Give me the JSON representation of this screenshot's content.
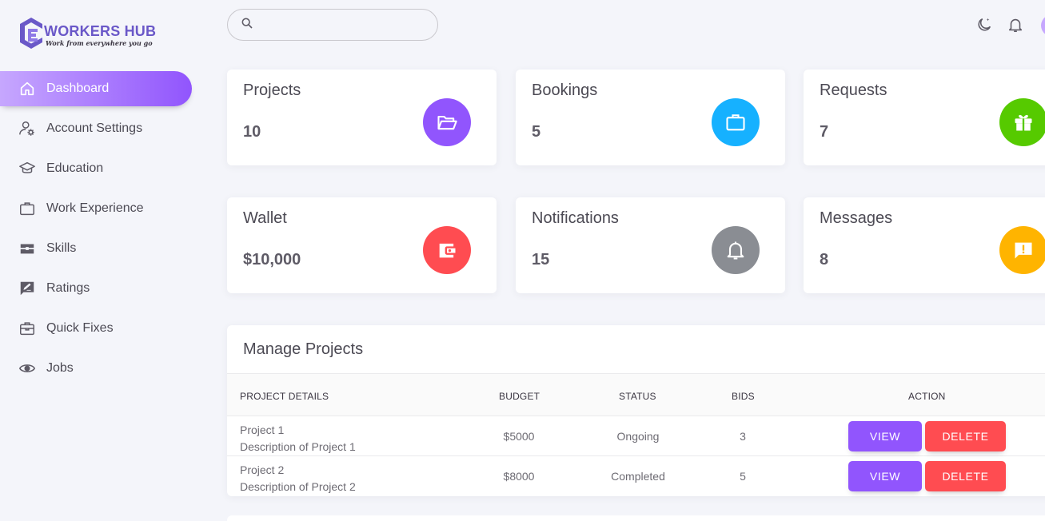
{
  "brand": {
    "name": "WORKERS HUB",
    "tagline": "Work from everywhere you go",
    "color": "#6a58c8"
  },
  "sidebar": {
    "items": [
      {
        "label": "Dashboard",
        "icon": "home-icon",
        "active": true
      },
      {
        "label": "Account Settings",
        "icon": "account-cog-icon"
      },
      {
        "label": "Education",
        "icon": "school-icon"
      },
      {
        "label": "Work Experience",
        "icon": "briefcase-icon"
      },
      {
        "label": "Skills",
        "icon": "toolbox-icon"
      },
      {
        "label": "Ratings",
        "icon": "rating-draw-icon"
      },
      {
        "label": "Quick Fixes",
        "icon": "medical-bag-icon"
      },
      {
        "label": "Jobs",
        "icon": "eye-icon"
      }
    ]
  },
  "topbar": {
    "search_placeholder": "",
    "icons": [
      "search-icon",
      "theme-moon-icon",
      "notification-bell-icon",
      "user-avatar"
    ]
  },
  "cards": [
    {
      "title": "Projects",
      "value": "10",
      "icon": "folder-open-icon",
      "color": "#9155fd"
    },
    {
      "title": "Bookings",
      "value": "5",
      "icon": "briefcase-icon",
      "color": "#16b1ff"
    },
    {
      "title": "Requests",
      "value": "7",
      "icon": "gift-icon",
      "color": "#56ca00"
    },
    {
      "title": "Wallet",
      "value": "$10,000",
      "icon": "wallet-icon",
      "color": "#ff4c51"
    },
    {
      "title": "Notifications",
      "value": "15",
      "icon": "bell-icon",
      "color": "#8a8d93"
    },
    {
      "title": "Messages",
      "value": "8",
      "icon": "message-alert-icon",
      "color": "#ffb400"
    }
  ],
  "projects_table": {
    "title": "Manage Projects",
    "columns": [
      "PROJECT DETAILS",
      "BUDGET",
      "STATUS",
      "BIDS",
      "ACTION"
    ],
    "rows": [
      {
        "name": "Project 1",
        "description": "Description of Project 1",
        "budget": "$5000",
        "status": "Ongoing",
        "bids": "3"
      },
      {
        "name": "Project 2",
        "description": "Description of Project 2",
        "budget": "$8000",
        "status": "Completed",
        "bids": "5"
      }
    ],
    "view_label": "VIEW",
    "delete_label": "DELETE"
  }
}
